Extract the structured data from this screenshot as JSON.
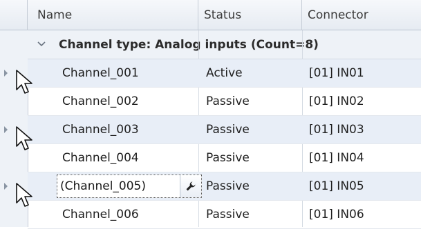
{
  "columns": {
    "name": "Name",
    "status": "Status",
    "connector": "Connector"
  },
  "group": {
    "label": "Channel type: Analog inputs (Count=8)",
    "expanded": true
  },
  "rows": [
    {
      "name": "Channel_001",
      "status": "Active",
      "connector": "[01] IN01"
    },
    {
      "name": "Channel_002",
      "status": "Passive",
      "connector": "[01] IN02"
    },
    {
      "name": "Channel_003",
      "status": "Passive",
      "connector": "[01] IN03"
    },
    {
      "name": "Channel_004",
      "status": "Passive",
      "connector": "[01] IN04"
    },
    {
      "name": "(Channel_005)",
      "status": "Passive",
      "connector": "[01] IN05"
    },
    {
      "name": "Channel_006",
      "status": "Passive",
      "connector": "[01] IN06"
    }
  ],
  "icons": {
    "group_toggle": "chevron-down-icon",
    "edit_button": "wrench-icon",
    "row_indicator": "triangle-right-icon",
    "pointer": "mouse-cursor-icon"
  },
  "colors": {
    "header_bg": "#e6ebf2",
    "alt_row_bg": "#e8eef7",
    "grid_line": "#d5dbe3"
  }
}
